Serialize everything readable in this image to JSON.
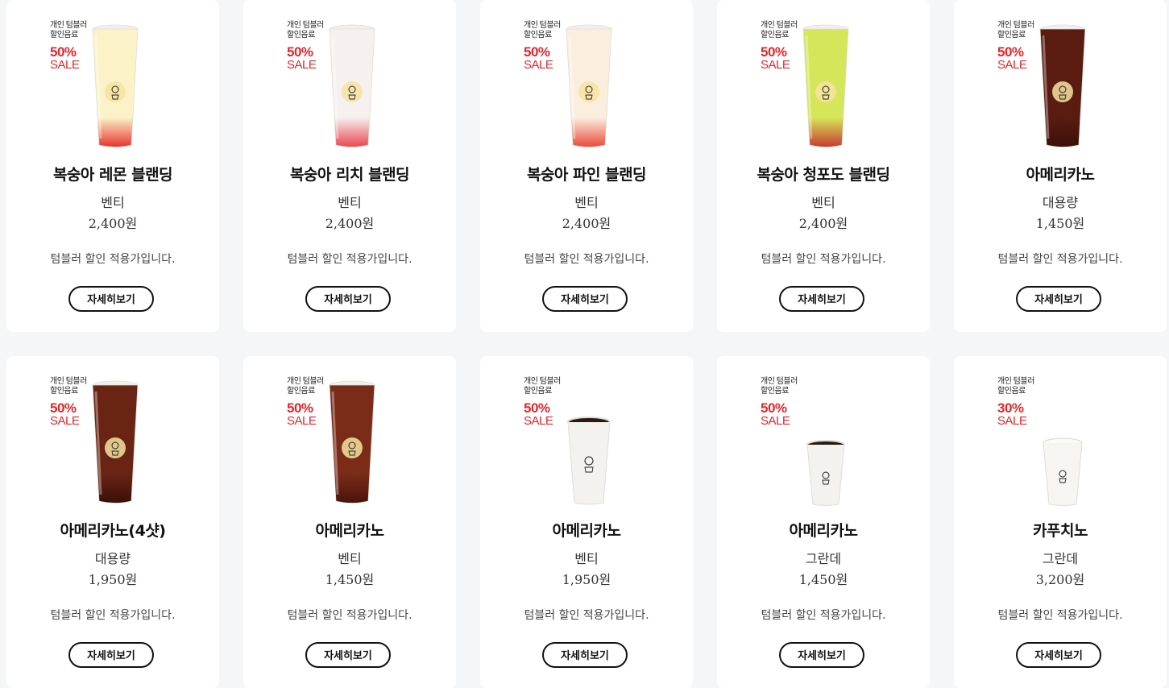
{
  "products": [
    {
      "tag_line1": "개인 텀블러",
      "tag_line2": "할인음료",
      "discount": "50%",
      "sale": "SALE",
      "name": "복숭아 레몬 블랜딩",
      "size": "벤티",
      "price": "2,400원",
      "note": "텀블러 할인 적용가입니다.",
      "button": "자세히보기",
      "drink": "peach-lemon",
      "liquid_top": "#fbf2c8",
      "liquid_bottom": "#e8332c",
      "cup": "iced"
    },
    {
      "tag_line1": "개인 텀블러",
      "tag_line2": "할인음료",
      "discount": "50%",
      "sale": "SALE",
      "name": "복숭아 리치 블랜딩",
      "size": "벤티",
      "price": "2,400원",
      "note": "텀블러 할인 적용가입니다.",
      "button": "자세히보기",
      "drink": "peach-lychee",
      "liquid_top": "#f6f0ee",
      "liquid_bottom": "#e84850",
      "cup": "iced"
    },
    {
      "tag_line1": "개인 텀블러",
      "tag_line2": "할인음료",
      "discount": "50%",
      "sale": "SALE",
      "name": "복숭아 파인 블랜딩",
      "size": "벤티",
      "price": "2,400원",
      "note": "텀블러 할인 적용가입니다.",
      "button": "자세히보기",
      "drink": "peach-pine",
      "liquid_top": "#fbeede",
      "liquid_bottom": "#ea4a3a",
      "cup": "iced"
    },
    {
      "tag_line1": "개인 텀블러",
      "tag_line2": "할인음료",
      "discount": "50%",
      "sale": "SALE",
      "name": "복숭아 청포도 블랜딩",
      "size": "벤티",
      "price": "2,400원",
      "note": "텀블러 할인 적용가입니다.",
      "button": "자세히보기",
      "drink": "peach-grape",
      "liquid_top": "#d6e65a",
      "liquid_bottom": "#c83a2e",
      "cup": "iced"
    },
    {
      "tag_line1": "개인 텀블러",
      "tag_line2": "할인음료",
      "discount": "50%",
      "sale": "SALE",
      "name": "아메리카노",
      "size": "대용량",
      "price": "1,450원",
      "note": "텀블러 할인 적용가입니다.",
      "button": "자세히보기",
      "drink": "iced-americano",
      "liquid_top": "#5a1c10",
      "liquid_bottom": "#3b0f08",
      "cup": "iced"
    },
    {
      "tag_line1": "개인 텀블러",
      "tag_line2": "할인음료",
      "discount": "50%",
      "sale": "SALE",
      "name": "아메리카노(4샷)",
      "size": "대용량",
      "price": "1,950원",
      "note": "텀블러 할인 적용가입니다.",
      "button": "자세히보기",
      "drink": "iced-americano-4shot",
      "liquid_top": "#6a2414",
      "liquid_bottom": "#3b0f08",
      "cup": "iced"
    },
    {
      "tag_line1": "개인 텀블러",
      "tag_line2": "할인음료",
      "discount": "50%",
      "sale": "SALE",
      "name": "아메리카노",
      "size": "벤티",
      "price": "1,450원",
      "note": "텀블러 할인 적용가입니다.",
      "button": "자세히보기",
      "drink": "iced-americano-venti",
      "liquid_top": "#7a2c18",
      "liquid_bottom": "#4a140a",
      "cup": "iced"
    },
    {
      "tag_line1": "개인 텀블러",
      "tag_line2": "할인음료",
      "discount": "50%",
      "sale": "SALE",
      "name": "아메리카노",
      "size": "벤티",
      "price": "1,950원",
      "note": "텀블러 할인 적용가입니다.",
      "button": "자세히보기",
      "drink": "hot-americano-venti",
      "liquid_top": "#2a1a12",
      "liquid_bottom": "#2a1a12",
      "cup": "hot"
    },
    {
      "tag_line1": "개인 텀블러",
      "tag_line2": "할인음료",
      "discount": "50%",
      "sale": "SALE",
      "name": "아메리카노",
      "size": "그란데",
      "price": "1,450원",
      "note": "텀블러 할인 적용가입니다.",
      "button": "자세히보기",
      "drink": "hot-americano-grande",
      "liquid_top": "#2a1a12",
      "liquid_bottom": "#2a1a12",
      "cup": "hot-small"
    },
    {
      "tag_line1": "개인 텀블러",
      "tag_line2": "할인음료",
      "discount": "30%",
      "sale": "SALE",
      "name": "카푸치노",
      "size": "그란데",
      "price": "3,200원",
      "note": "텀블러 할인 적용가입니다.",
      "button": "자세히보기",
      "drink": "cappuccino",
      "liquid_top": "#ffffff",
      "liquid_bottom": "#ffffff",
      "cup": "hot-lid"
    }
  ]
}
